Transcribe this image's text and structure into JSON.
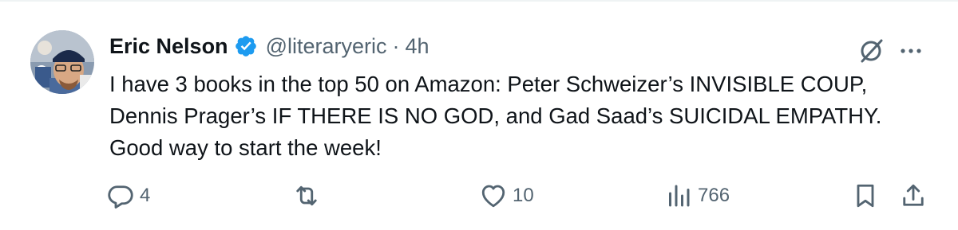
{
  "author": {
    "name": "Eric Nelson",
    "handle": "@literaryeric",
    "separator": "·",
    "time": "4h",
    "verified": true
  },
  "tweet": {
    "text": "I have 3 books in the top 50 on Amazon: Peter Schweizer’s INVISIBLE COUP, Dennis Prager’s IF THERE IS NO GOD, and Gad Saad’s SUICIDAL EMPATHY. Good way to start the week!"
  },
  "metrics": {
    "replies": "4",
    "reposts": "",
    "likes": "10",
    "views": "766"
  },
  "icons": {
    "verified": "verified-badge-icon",
    "grok": "grok-icon",
    "more": "more-options-icon",
    "reply": "reply-icon",
    "repost": "repost-icon",
    "like": "heart-icon",
    "views": "views-chart-icon",
    "bookmark": "bookmark-icon",
    "share": "share-icon"
  },
  "colors": {
    "text": "#0f1419",
    "secondary": "#536471",
    "verified": "#1d9bf0",
    "background": "#ffffff"
  }
}
